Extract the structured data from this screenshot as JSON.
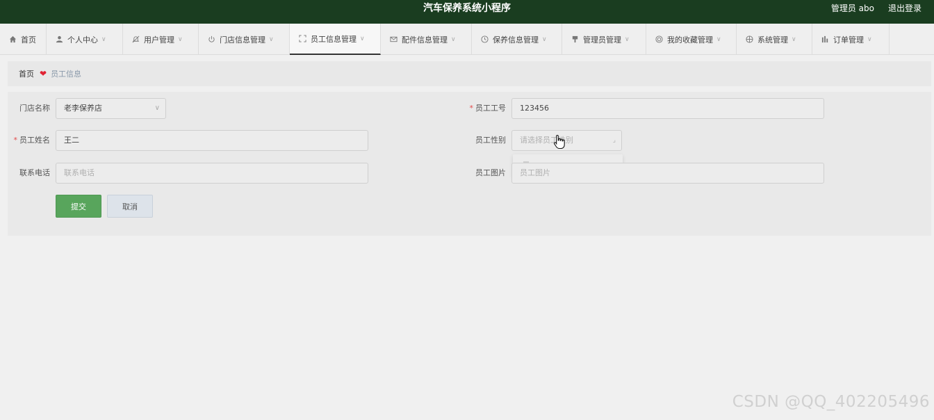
{
  "header": {
    "title": "汽车保养系统小程序",
    "user": "管理员 abo",
    "logout": "退出登录"
  },
  "nav": {
    "items": [
      {
        "label": "首页",
        "icon": "home-icon"
      },
      {
        "label": "个人中心",
        "icon": "user-icon"
      },
      {
        "label": "用户管理",
        "icon": "bell-off-icon"
      },
      {
        "label": "门店信息管理",
        "icon": "power-icon"
      },
      {
        "label": "员工信息管理",
        "icon": "fullscreen-icon"
      },
      {
        "label": "配件信息管理",
        "icon": "mail-icon"
      },
      {
        "label": "保养信息管理",
        "icon": "clock-icon"
      },
      {
        "label": "管理员管理",
        "icon": "pin-icon"
      },
      {
        "label": "我的收藏管理",
        "icon": "target-icon"
      },
      {
        "label": "系统管理",
        "icon": "compass-icon"
      },
      {
        "label": "订单管理",
        "icon": "chart-icon"
      }
    ],
    "active_index": 4
  },
  "breadcrumb": {
    "home": "首页",
    "current": "员工信息"
  },
  "form": {
    "store": {
      "label": "门店名称",
      "value": "老李保养店"
    },
    "staff_no": {
      "label": "员工工号",
      "value": "123456"
    },
    "name": {
      "label": "员工姓名",
      "value": "王二"
    },
    "gender": {
      "label": "员工性别",
      "placeholder": "请选择员工性别"
    },
    "phone": {
      "label": "联系电话",
      "placeholder": "联系电话"
    },
    "photo": {
      "label": "员工图片",
      "placeholder": "员工图片"
    },
    "submit": "提交",
    "cancel": "取消"
  },
  "watermark": "CSDN @QQ_402205496",
  "colors": {
    "header_bg": "#1a3d20",
    "submit_bg": "#58a55c",
    "required": "#e24b4b",
    "heart": "#e02233"
  }
}
